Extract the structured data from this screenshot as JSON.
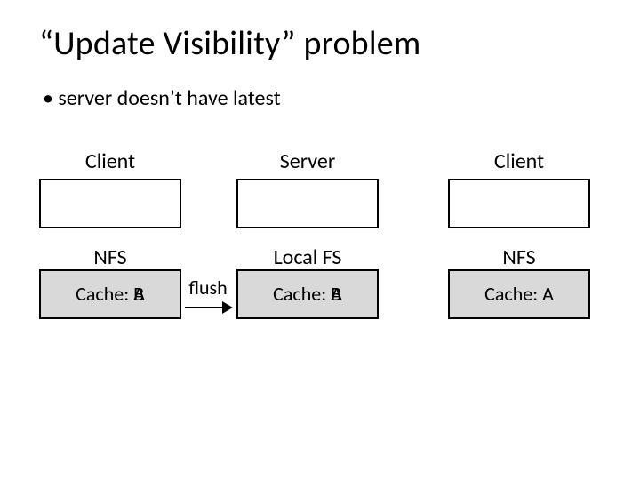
{
  "title": "“Update Visibility” problem",
  "bullet": "server doesn’t have latest",
  "headers": {
    "left": "Client",
    "mid": "Server",
    "right": "Client"
  },
  "flush_label": "flush",
  "boxes": {
    "left": {
      "name": "NFS",
      "cache_prefix": "Cache: ",
      "cache_under": "A",
      "cache_over": "B"
    },
    "mid": {
      "name": "Local FS",
      "cache_prefix": "Cache: ",
      "cache_under": "A",
      "cache_over": "B"
    },
    "right": {
      "name": "NFS",
      "cache_prefix": "Cache: ",
      "cache_value": "A"
    }
  }
}
